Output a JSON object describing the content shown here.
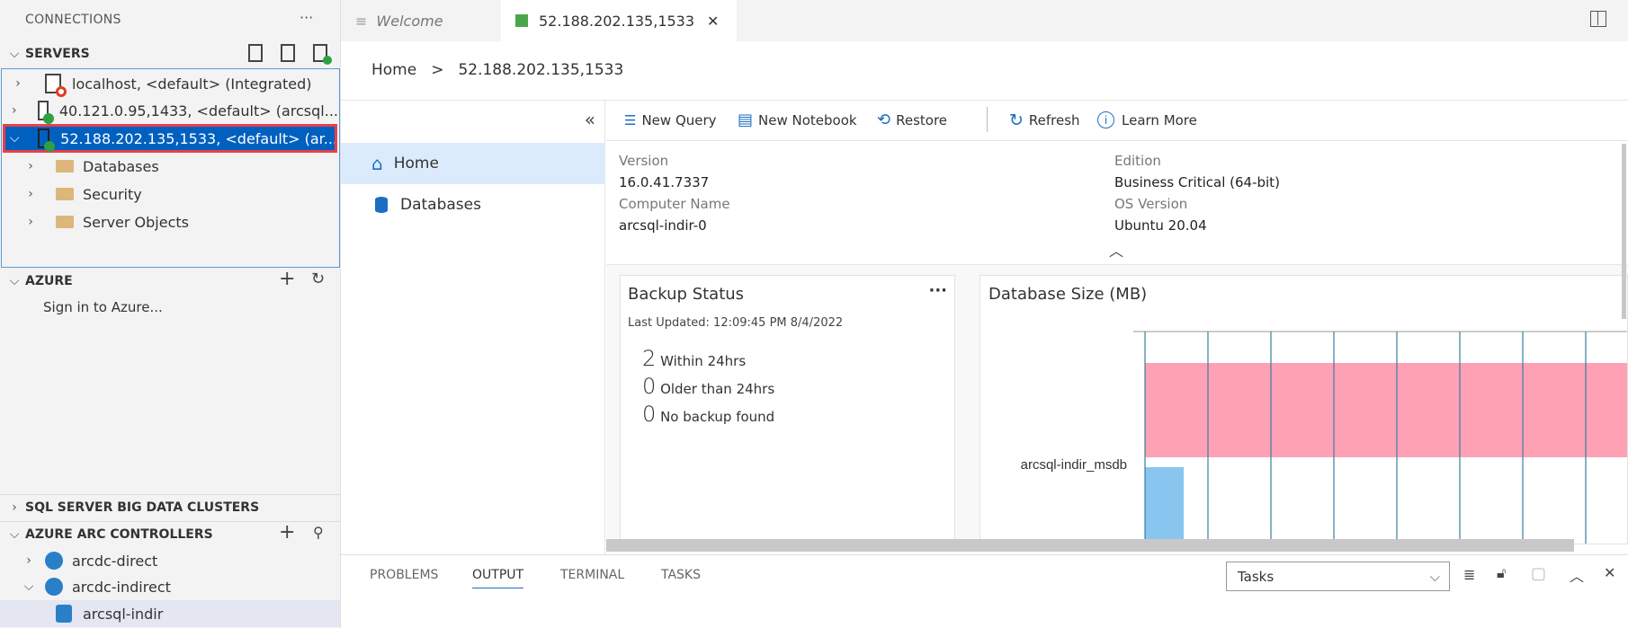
{
  "sidebar": {
    "header": "CONNECTIONS",
    "more": "···",
    "servers": {
      "title": "SERVERS",
      "items": [
        {
          "label": "localhost, <default> (Integrated)",
          "status": "disconnected"
        },
        {
          "label": "40.121.0.95,1433, <default> (arcsql...",
          "status": "connected"
        },
        {
          "label": "52.188.202.135,1533, <default> (ar...",
          "status": "connected",
          "selected": true
        }
      ],
      "children": [
        "Databases",
        "Security",
        "Server Objects"
      ]
    },
    "azure": {
      "title": "AZURE",
      "sign_in": "Sign in to Azure..."
    },
    "big_data": {
      "title": "SQL SERVER BIG DATA CLUSTERS"
    },
    "arc": {
      "title": "AZURE ARC CONTROLLERS",
      "items": [
        "arcdc-direct",
        "arcdc-indirect"
      ],
      "child": "arcsql-indir"
    }
  },
  "tabs": [
    {
      "label": "Welcome"
    },
    {
      "label": "52.188.202.135,1533",
      "active": true
    }
  ],
  "breadcrumb": {
    "home": "Home",
    "sep": ">",
    "current": "52.188.202.135,1533"
  },
  "nav": {
    "collapse": "«",
    "items": [
      {
        "label": "Home",
        "selected": true
      },
      {
        "label": "Databases"
      }
    ]
  },
  "toolbar": {
    "new_query": "New Query",
    "new_notebook": "New Notebook",
    "restore": "Restore",
    "refresh": "Refresh",
    "learn_more": "Learn More"
  },
  "info": {
    "version_label": "Version",
    "version": "16.0.41.7337",
    "edition_label": "Edition",
    "edition": "Business Critical (64-bit)",
    "computer_label": "Computer Name",
    "computer": "arcsql-indir-0",
    "os_label": "OS Version",
    "os": "Ubuntu 20.04"
  },
  "backup": {
    "title": "Backup Status",
    "more": "···",
    "updated": "Last Updated: 12:09:45 PM 8/4/2022",
    "stats": [
      {
        "count": "2",
        "label": "Within 24hrs"
      },
      {
        "count": "0",
        "label": "Older than 24hrs"
      },
      {
        "count": "0",
        "label": "No backup found"
      }
    ]
  },
  "chart_data": {
    "type": "bar",
    "orientation": "horizontal",
    "title": "Database Size (MB)",
    "categories": [
      "arcsql-indir_msdb"
    ],
    "series": [
      {
        "color": "#ffa1b5"
      },
      {
        "color": "#88c6f0"
      }
    ],
    "grid": true
  },
  "panel": {
    "tabs": [
      "PROBLEMS",
      "OUTPUT",
      "TERMINAL",
      "TASKS"
    ],
    "active": "OUTPUT",
    "select": "Tasks"
  }
}
